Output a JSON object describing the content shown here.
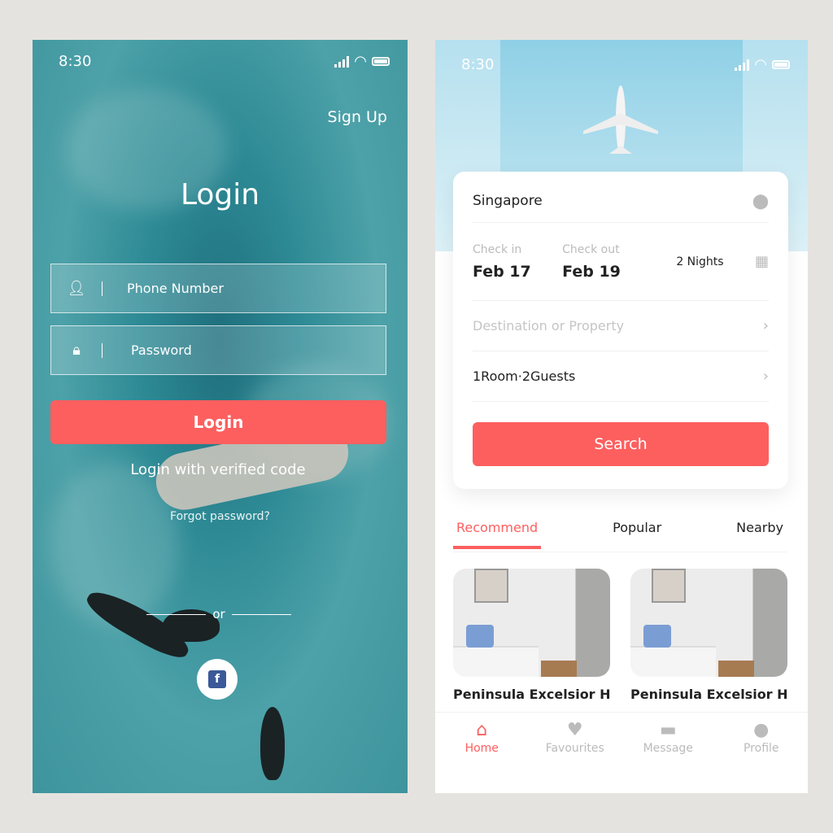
{
  "colors": {
    "accent": "#fd5f5f",
    "page_bg": "#e5e3df"
  },
  "login": {
    "status": {
      "time": "8:30"
    },
    "sign_up": "Sign Up",
    "title": "Login",
    "phone_placeholder": "Phone Number",
    "password_placeholder": "Password",
    "login_button": "Login",
    "verified_code": "Login with verified code",
    "forgot": "Forgot password?",
    "or": "or",
    "facebook_glyph": "f"
  },
  "home": {
    "status": {
      "time": "8:30"
    },
    "city": "Singapore",
    "check_in_label": "Check in",
    "check_in": "Feb 17",
    "check_out_label": "Check out",
    "check_out": "Feb 19",
    "nights": "2 Nights",
    "destination_placeholder": "Destination or Property",
    "rooms": "1Room·2Guests",
    "search_button": "Search",
    "tabs": [
      {
        "label": "Recommend",
        "active": true
      },
      {
        "label": "Popular"
      },
      {
        "label": "Nearby"
      }
    ],
    "hotels": [
      {
        "name": "Peninsula Excelsior Hotel"
      },
      {
        "name": "Peninsula Excelsior Hotel"
      }
    ],
    "nav": [
      {
        "label": "Home",
        "icon": "home-icon",
        "active": true
      },
      {
        "label": "Favourites",
        "icon": "heart-icon"
      },
      {
        "label": "Message",
        "icon": "message-icon"
      },
      {
        "label": "Profile",
        "icon": "profile-icon"
      }
    ]
  }
}
